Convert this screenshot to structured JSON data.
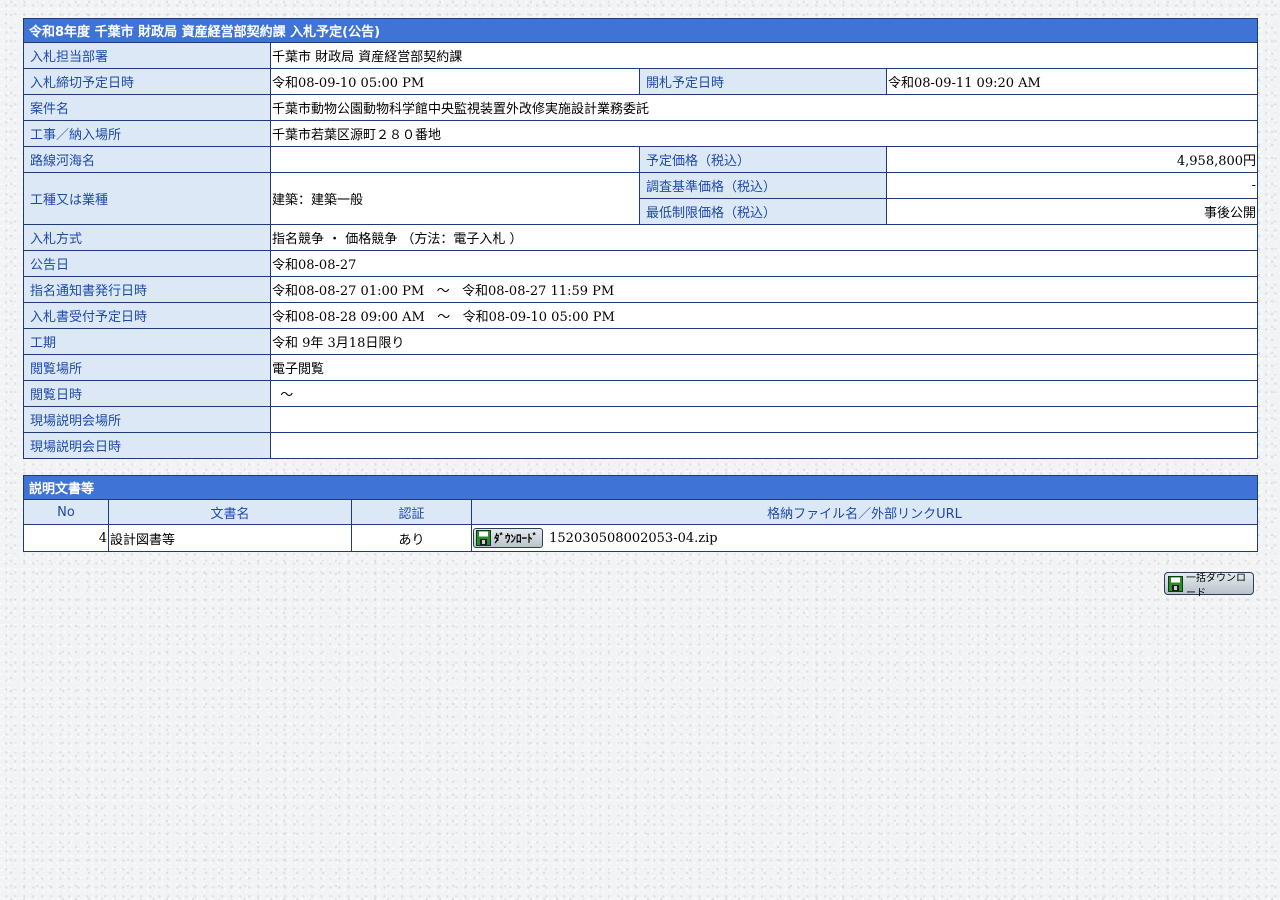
{
  "notice": {
    "title": "令和8年度  千葉市  財政局  資産経営部契約課  入札予定(公告)",
    "rows": {
      "dept": {
        "label": "入札担当部署",
        "value": "千葉市  財政局  資産経営部契約課"
      },
      "deadline": {
        "label": "入札締切予定日時",
        "value": "令和08-09-10 05:00 PM"
      },
      "opening": {
        "label": "開札予定日時",
        "value": "令和08-09-11 09:20 AM"
      },
      "case_name": {
        "label": "案件名",
        "value": "千葉市動物公園動物科学館中央監視装置外改修実施設計業務委託"
      },
      "location": {
        "label": "工事／納入場所",
        "value": "千葉市若葉区源町２８０番地"
      },
      "route": {
        "label": "路線河海名",
        "value": ""
      },
      "planned_price": {
        "label": "予定価格（税込）",
        "value": "4,958,800円"
      },
      "work_type": {
        "label": "工種又は業種",
        "value": "建築：建築一般"
      },
      "survey_price": {
        "label": "調査基準価格（税込）",
        "value": "-"
      },
      "min_price": {
        "label": "最低制限価格（税込）",
        "value": "事後公開"
      },
      "method": {
        "label": "入札方式",
        "value": "指名競争 ・ 価格競争 （方法：電子入札 ）"
      },
      "announce_date": {
        "label": "公告日",
        "value": "令和08-08-27"
      },
      "notice_issue": {
        "label": "指名通知書発行日時",
        "value": "令和08-08-27 01:00 PM   ～   令和08-08-27 11:59 PM"
      },
      "bid_receipt": {
        "label": "入札書受付予定日時",
        "value": "令和08-08-28 09:00 AM   ～   令和08-09-10 05:00 PM"
      },
      "period": {
        "label": "工期",
        "value": "令和 9年 3月18日限り"
      },
      "viewing_place": {
        "label": "閲覧場所",
        "value": "電子閲覧"
      },
      "viewing_date": {
        "label": "閲覧日時",
        "value": "  ～"
      },
      "site_place": {
        "label": "現場説明会場所",
        "value": ""
      },
      "site_date": {
        "label": "現場説明会日時",
        "value": ""
      }
    }
  },
  "documents": {
    "title": "説明文書等",
    "headers": {
      "no": "No",
      "name": "文書名",
      "auth": "認証",
      "file": "格納ファイル名／外部リンクURL"
    },
    "rows": [
      {
        "no": "4",
        "name": "設計図書等",
        "auth": "あり",
        "button": "ﾀﾞｳﾝﾛｰﾄﾞ",
        "file": "152030508002053-04.zip"
      }
    ]
  },
  "bulk_download": {
    "label": "一括ダウンロード"
  },
  "colors": {
    "title_bg": "#3f74d6",
    "label_bg": "#dce8f6",
    "label_text": "#1d4aa8",
    "border": "#1f3a78"
  }
}
